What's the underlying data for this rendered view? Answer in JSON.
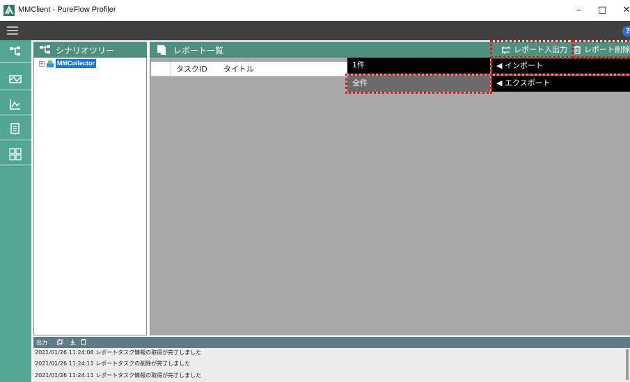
{
  "window": {
    "title": "MMClient - PureFlow Profiler",
    "minimize_glyph": "–",
    "maximize_glyph": "□",
    "close_glyph": "✕"
  },
  "menubar": {
    "help_glyph": "?"
  },
  "left_nav": [
    {
      "icon": "scenario-tree-icon"
    },
    {
      "icon": "traffic-icon"
    },
    {
      "icon": "chart-icon"
    },
    {
      "icon": "report-icon"
    },
    {
      "icon": "grid-settings-icon"
    }
  ],
  "scenario_tree": {
    "title": "シナリオツリー",
    "root_node": "MMCollector",
    "expander": "+"
  },
  "report_list": {
    "title": "レポート一覧",
    "io_button": "レポート入出力",
    "delete_button": "レポート削除",
    "columns": [
      "タスクID",
      "タイトル"
    ]
  },
  "report_menu": {
    "count_1": "1件",
    "count_all": "全件",
    "import": "◀ インポート",
    "export": "◀ エクスポート"
  },
  "output_panel": {
    "title": "出力",
    "logs": [
      "2021/01/26 11:24:08 レポートタスク情報の取得が完了しました",
      "2021/01/26 11:24:11 レポートタスクの削除が完了しました",
      "2021/01/26 11:24:11 レポートタスク情報の取得が完了しました"
    ]
  },
  "colors": {
    "accent": "#52a792",
    "panel_header": "#4f8f7f",
    "highlight_dash": "#e0141e",
    "menubar": "#404040"
  }
}
